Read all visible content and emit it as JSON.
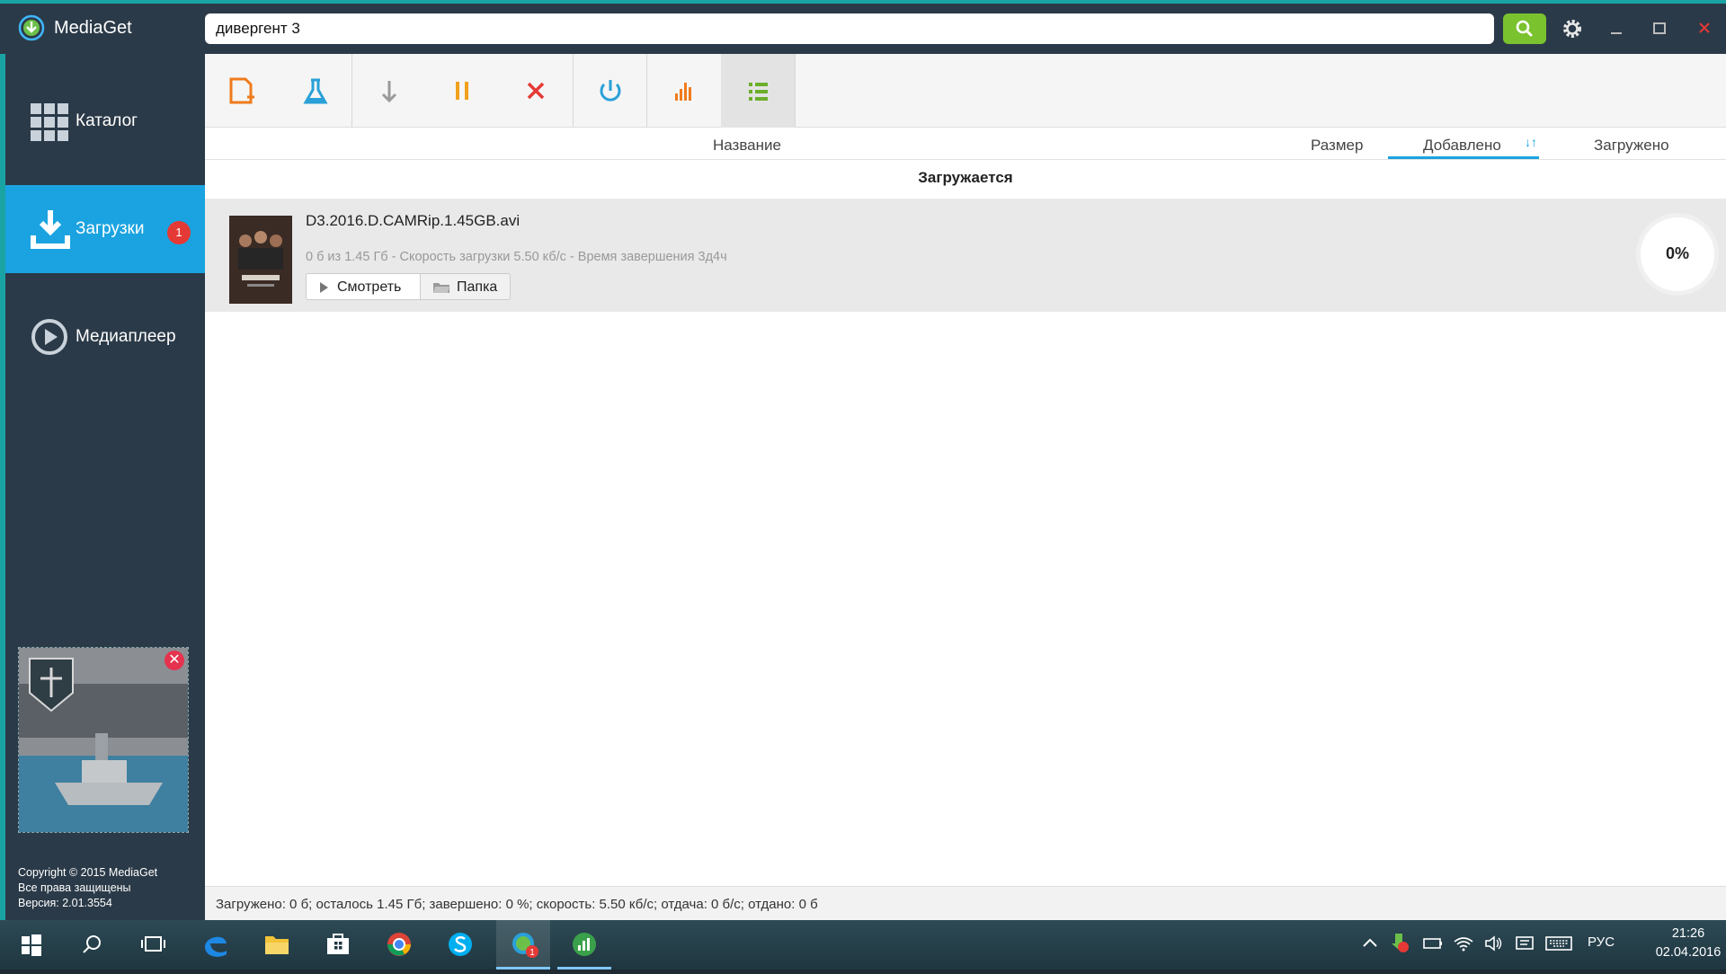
{
  "app": {
    "title": "MediaGet"
  },
  "search": {
    "value": "дивергент 3"
  },
  "sidebar": {
    "items": [
      {
        "label": "Каталог",
        "icon": "grid-icon"
      },
      {
        "label": "Загрузки",
        "icon": "download-icon",
        "badge": "1",
        "active": true
      },
      {
        "label": "Медиаплеер",
        "icon": "play-circle-icon"
      }
    ],
    "copyright": [
      "Copyright © 2015 MediaGet",
      "Все права защищены",
      "Версия: 2.01.3554"
    ]
  },
  "toolbar": {
    "buttons": [
      "add-file-icon",
      "flask-icon",
      "arrow-down-icon",
      "pause-icon",
      "delete-icon",
      "power-icon",
      "chart-icon",
      "list-icon"
    ]
  },
  "columns": {
    "name": "Название",
    "size": "Размер",
    "added": "Добавлено",
    "sort_indicator": "↓↑",
    "loaded": "Загружено"
  },
  "group": {
    "title": "Загружается"
  },
  "download": {
    "file_name": "D3.2016.D.CAMRip.1.45GB.avi",
    "status": "0 б из 1.45 Гб - Скорость загрузки 5.50 кб/с - Время завершения 3д4ч",
    "watch_label": "Смотреть",
    "folder_label": "Папка",
    "progress": "0%"
  },
  "status_bar": {
    "text": "Загружено: 0 б; осталось 1.45 Гб; завершено: 0 %; скорость: 5.50 кб/с; отдача: 0 б/с; отдано: 0 б"
  },
  "taskbar": {
    "lang": "РУС",
    "time": "21:26",
    "date": "02.04.2016",
    "mediaget_badge": "1"
  },
  "colors": {
    "accent": "#1aa3e0",
    "sidebar": "#2b3a48",
    "teal": "#1aa3a3",
    "search_btn": "#7bc22f"
  }
}
